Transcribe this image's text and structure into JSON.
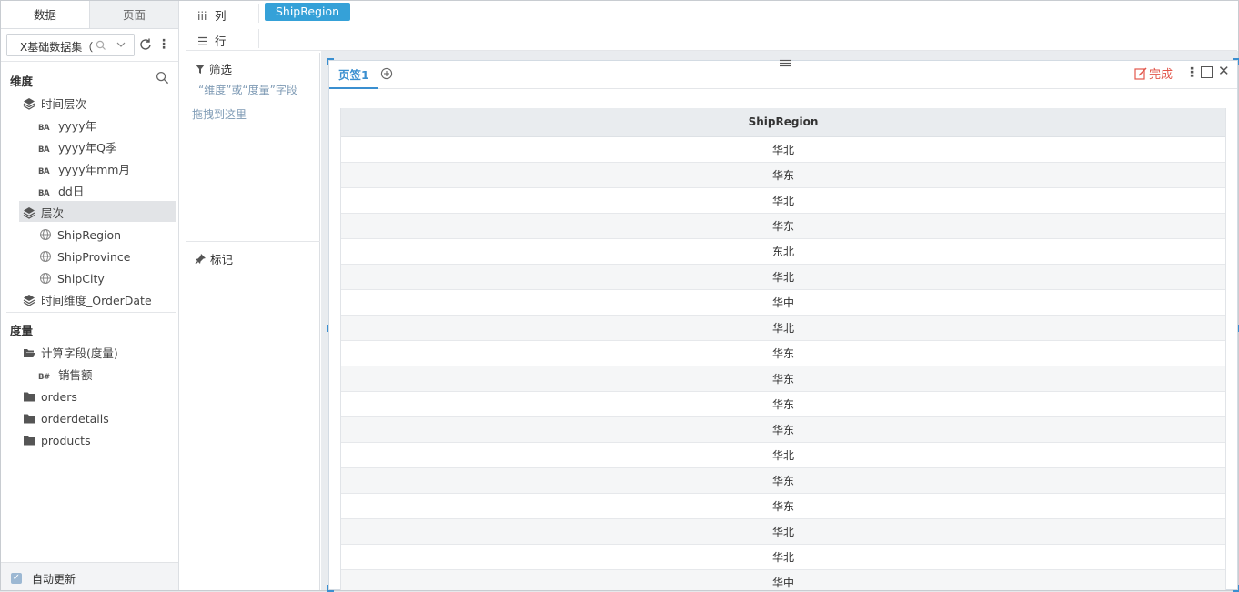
{
  "left_panel": {
    "tabs": [
      {
        "label": "数据"
      },
      {
        "label": "页面"
      }
    ],
    "dataset": {
      "name": "X基础数据集（"
    },
    "dimensions": {
      "title": "维度",
      "items": [
        {
          "label": "时间层次"
        },
        {
          "label": "yyyy年"
        },
        {
          "label": "yyyy年Q季"
        },
        {
          "label": "yyyy年mm月"
        },
        {
          "label": "dd日"
        },
        {
          "label": "层次"
        },
        {
          "label": "ShipRegion"
        },
        {
          "label": "ShipProvince"
        },
        {
          "label": "ShipCity"
        },
        {
          "label": "时间维度_OrderDate"
        }
      ]
    },
    "measures": {
      "title": "度量",
      "items": [
        {
          "label": "计算字段(度量)"
        },
        {
          "label": "销售额"
        },
        {
          "label": "orders"
        },
        {
          "label": "orderdetails"
        },
        {
          "label": "products"
        }
      ]
    },
    "auto_update": {
      "label": "自动更新",
      "checked": true
    }
  },
  "shelves": {
    "columns": {
      "label": "列",
      "field": "ShipRegion"
    },
    "rows": {
      "label": "行"
    }
  },
  "mid_panel": {
    "filter": {
      "label": "筛选",
      "hint_line1": "“维度”或“度量”字段",
      "hint_line2": "拖拽到这里"
    },
    "marks": {
      "label": "标记"
    }
  },
  "widget": {
    "tab_label": "页签1",
    "done_label": "完成",
    "table": {
      "header": "ShipRegion",
      "rows": [
        "华北",
        "华东",
        "华北",
        "华东",
        "东北",
        "华北",
        "华中",
        "华北",
        "华东",
        "华东",
        "华东",
        "华东",
        "华北",
        "华东",
        "华东",
        "华北",
        "华北",
        "华中"
      ]
    }
  },
  "colors": {
    "accent": "#35a1d8",
    "done": "#e2574c"
  }
}
